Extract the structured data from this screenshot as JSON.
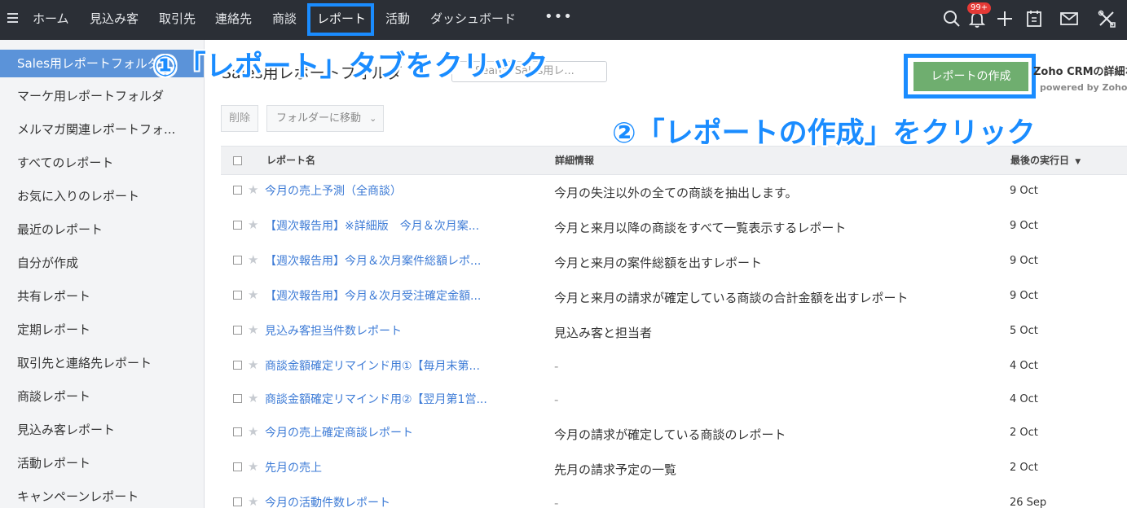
{
  "nav": {
    "items": [
      "ホーム",
      "見込み客",
      "取引先",
      "連絡先",
      "商談",
      "レポート",
      "活動",
      "ダッシュボード"
    ],
    "more": "•••",
    "notification_badge": "99+",
    "icons": [
      "search-icon",
      "bell-icon",
      "plus-icon",
      "calendar-icon",
      "mail-icon",
      "tools-icon"
    ]
  },
  "sidebar": {
    "items": [
      "Sales用レポートフォルダ",
      "マーケ用レポートフォルダ",
      "メルマガ関連レポートフォ...",
      "すべてのレポート",
      "お気に入りのレポート",
      "最近のレポート",
      "自分が作成",
      "共有レポート",
      "定期レポート",
      "取引先と連絡先レポート",
      "商談レポート",
      "見込み客レポート",
      "活動レポート",
      "キャンペーンレポート"
    ]
  },
  "main": {
    "folder_title": "Sales用レポートフォルダ",
    "search_placeholder": "Search Sales用レ...",
    "create_button": "レポートの作成",
    "zoho_info": "Zoho CRMの詳細な",
    "powered_by": "powered by Zoho レ",
    "delete_button": "削除",
    "move_button": "フォルダーに移動"
  },
  "table": {
    "headers": {
      "name": "レポート名",
      "detail": "詳細情報",
      "last_run": "最後の実行日"
    },
    "rows": [
      {
        "name": "今月の売上予測（全商談）",
        "detail": "今月の失注以外の全ての商談を抽出します。",
        "date": "9 Oct"
      },
      {
        "name": "【週次報告用】※詳細版　今月＆次月案...",
        "detail": "今月と来月以降の商談をすべて一覧表示するレポート",
        "date": "9 Oct"
      },
      {
        "name": "【週次報告用】今月＆次月案件総額レポ...",
        "detail": "今月と来月の案件総額を出すレポート",
        "date": "9 Oct"
      },
      {
        "name": "【週次報告用】今月＆次月受注確定金額...",
        "detail": "今月と来月の請求が確定している商談の合計金額を出すレポート",
        "date": "9 Oct"
      },
      {
        "name": "見込み客担当件数レポート",
        "detail": "見込み客と担当者",
        "date": "5 Oct"
      },
      {
        "name": "商談金額確定リマインド用①【毎月末第...",
        "detail": "-",
        "date": "4 Oct"
      },
      {
        "name": "商談金額確定リマインド用②【翌月第1営...",
        "detail": "-",
        "date": "4 Oct"
      },
      {
        "name": "今月の売上確定商談レポート",
        "detail": "今月の請求が確定している商談のレポート",
        "date": "2 Oct"
      },
      {
        "name": "先月の売上",
        "detail": "先月の請求予定の一覧",
        "date": "2 Oct"
      },
      {
        "name": "今月の活動件数レポート",
        "detail": "-",
        "date": "26 Sep"
      }
    ]
  },
  "annotations": {
    "step1": "①「レポート」タブをクリック",
    "step2": "②「レポートの作成」をクリック"
  },
  "colors": {
    "topbar": "#2b2f36",
    "accent": "#1a8cff",
    "sidebar_active": "#5b93d9",
    "create_button": "#6fae6f",
    "link": "#3d7bd6"
  }
}
